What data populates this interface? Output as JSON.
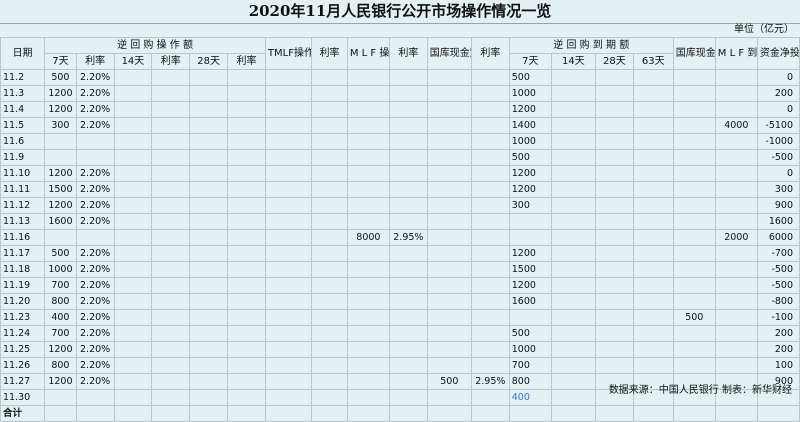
{
  "title": "2020年11月人民银行公开市场操作情况一览",
  "unit": "单位（亿元）",
  "header": {
    "date": "日期",
    "reverse_repo": "逆 回 购 操 作 额",
    "tmlf_op": "TMLF操作",
    "rate": "利率",
    "mlf_op": "M L F 操作",
    "treasury_deposit": "国库现金定存",
    "reverse_repo_due": "逆 回 购 到 期 额",
    "treasury_due": "国库现金到期额",
    "mlf_due": "M L F 到期",
    "net_injection": "资金净投放",
    "sub": {
      "d7": "7天",
      "rate": "利率",
      "d14": "14天",
      "d28": "28天",
      "d63": "63天"
    }
  },
  "rows": [
    {
      "date": "11.2",
      "rr7": "500",
      "rr7rate": "2.20%",
      "due7": "500",
      "net": "0"
    },
    {
      "date": "11.3",
      "rr7": "1200",
      "rr7rate": "2.20%",
      "due7": "1000",
      "net": "200"
    },
    {
      "date": "11.4",
      "rr7": "1200",
      "rr7rate": "2.20%",
      "due7": "1200",
      "net": "0"
    },
    {
      "date": "11.5",
      "rr7": "300",
      "rr7rate": "2.20%",
      "due7": "1400",
      "mlfdue": "4000",
      "net": "-5100"
    },
    {
      "date": "11.6",
      "due7": "1000",
      "net": "-1000"
    },
    {
      "date": "11.9",
      "due7": "500",
      "net": "-500"
    },
    {
      "date": "11.10",
      "rr7": "1200",
      "rr7rate": "2.20%",
      "due7": "1200",
      "net": "0"
    },
    {
      "date": "11.11",
      "rr7": "1500",
      "rr7rate": "2.20%",
      "due7": "1200",
      "net": "300"
    },
    {
      "date": "11.12",
      "rr7": "1200",
      "rr7rate": "2.20%",
      "due7": "300",
      "net": "900"
    },
    {
      "date": "11.13",
      "rr7": "1600",
      "rr7rate": "2.20%",
      "net": "1600"
    },
    {
      "date": "11.16",
      "mlf": "8000",
      "mlfrate": "2.95%",
      "mlfdue": "2000",
      "net": "6000"
    },
    {
      "date": "11.17",
      "rr7": "500",
      "rr7rate": "2.20%",
      "due7": "1200",
      "net": "-700"
    },
    {
      "date": "11.18",
      "rr7": "1000",
      "rr7rate": "2.20%",
      "due7": "1500",
      "net": "-500"
    },
    {
      "date": "11.19",
      "rr7": "700",
      "rr7rate": "2.20%",
      "due7": "1200",
      "net": "-500"
    },
    {
      "date": "11.20",
      "rr7": "800",
      "rr7rate": "2.20%",
      "due7": "1600",
      "net": "-800"
    },
    {
      "date": "11.23",
      "rr7": "400",
      "rr7rate": "2.20%",
      "tdue": "500",
      "net": "-100"
    },
    {
      "date": "11.24",
      "rr7": "700",
      "rr7rate": "2.20%",
      "due7": "500",
      "net": "200"
    },
    {
      "date": "11.25",
      "rr7": "1200",
      "rr7rate": "2.20%",
      "due7": "1000",
      "net": "200"
    },
    {
      "date": "11.26",
      "rr7": "800",
      "rr7rate": "2.20%",
      "due7": "700",
      "net": "100"
    },
    {
      "date": "11.27",
      "rr7": "1200",
      "rr7rate": "2.20%",
      "tdep": "500",
      "tdeprate": "2.95%",
      "due7": "800",
      "net": "900"
    },
    {
      "date": "11.30",
      "due7": "400",
      "due7_blue": true
    },
    {
      "date": "合计",
      "bold": true
    }
  ],
  "footer": "数据来源：中国人民银行  制表：新华财经"
}
